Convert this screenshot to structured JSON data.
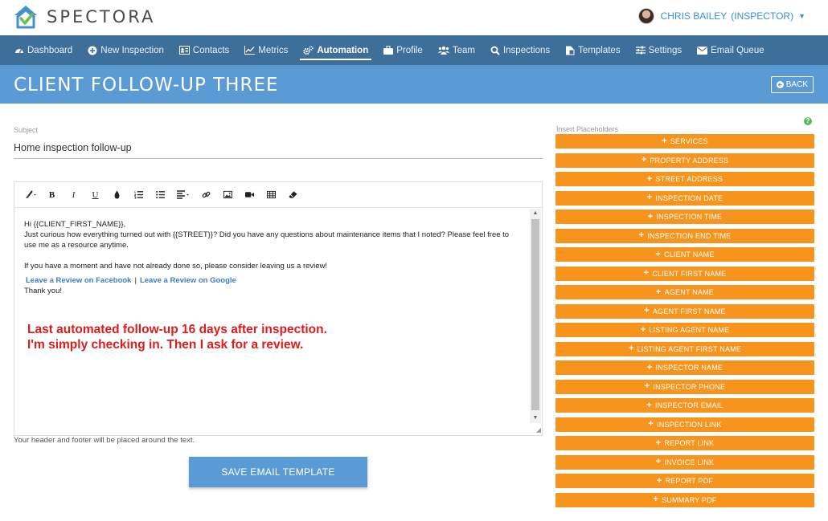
{
  "brand": {
    "name": "SPECTORA"
  },
  "user": {
    "name": "CHRIS BAILEY",
    "role": "(INSPECTOR)"
  },
  "nav": [
    {
      "label": "Dashboard",
      "icon": "dashboard-icon"
    },
    {
      "label": "New Inspection",
      "icon": "plus-circle-icon"
    },
    {
      "label": "Contacts",
      "icon": "contacts-icon"
    },
    {
      "label": "Metrics",
      "icon": "chart-icon"
    },
    {
      "label": "Automation",
      "icon": "gears-icon",
      "active": true
    },
    {
      "label": "Profile",
      "icon": "briefcase-icon"
    },
    {
      "label": "Team",
      "icon": "team-icon"
    },
    {
      "label": "Inspections",
      "icon": "search-icon"
    },
    {
      "label": "Templates",
      "icon": "templates-icon"
    },
    {
      "label": "Settings",
      "icon": "sliders-icon"
    },
    {
      "label": "Email Queue",
      "icon": "envelope-icon"
    }
  ],
  "page": {
    "title": "CLIENT FOLLOW-UP THREE",
    "back_label": "BACK"
  },
  "subject": {
    "label": "Subject",
    "value": "Home inspection follow-up"
  },
  "editor": {
    "greeting": "Hi {{CLIENT_FIRST_NAME}},",
    "body1": "Just curious how everything turned out with {{STREET}}? Did you have any questions about maintenance items that I noted? Please feel free to use me as a resource anytime.",
    "body2": "If you have a moment and have not already done so, please consider leaving us a review!",
    "link_facebook": "Leave a Review on Facebook",
    "link_separator": "|",
    "link_google": "Leave a Review on Google",
    "closing": "Thank you!",
    "annotation_line1": "Last automated follow-up 16 days after inspection.",
    "annotation_line2": "I'm simply checking in. Then I ask for a review."
  },
  "helper_text": "Your header and footer will be placed around the text.",
  "save_label": "SAVE EMAIL TEMPLATE",
  "placeholders": {
    "label": "Insert Placeholders",
    "items": [
      "SERVICES",
      "PROPERTY ADDRESS",
      "STREET ADDRESS",
      "INSPECTION DATE",
      "INSPECTION TIME",
      "INSPECTION END TIME",
      "CLIENT NAME",
      "CLIENT FIRST NAME",
      "AGENT NAME",
      "AGENT FIRST NAME",
      "LISTING AGENT NAME",
      "LISTING AGENT FIRST NAME",
      "INSPECTOR NAME",
      "INSPECTOR PHONE",
      "INSPECTOR EMAIL",
      "INSPECTION LINK",
      "REPORT LINK",
      "INVOICE LINK",
      "REPORT PDF",
      "SUMMARY PDF"
    ]
  },
  "colors": {
    "nav": "#3d6f9a",
    "title_band": "#5b9bd5",
    "placeholder": "#f7941d",
    "annotation": "#e01b1b"
  }
}
